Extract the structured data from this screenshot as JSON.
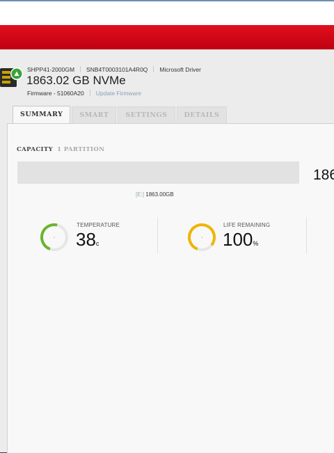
{
  "device": {
    "model": "SHPP41-2000GM",
    "serial": "SNB4T0003101A4R0Q",
    "driver": "Microsoft Driver",
    "title": "1863.02 GB NVMe",
    "firmware_label": "Firmware - 51060A20",
    "update_firmware_label": "Update Firmware",
    "icon": "ssd-drive-icon"
  },
  "tabs": [
    {
      "label": "SUMMARY",
      "active": true
    },
    {
      "label": "SMART",
      "active": false
    },
    {
      "label": "SETTINGS",
      "active": false
    },
    {
      "label": "DETAILS",
      "active": false
    }
  ],
  "capacity": {
    "heading": "CAPACITY",
    "partitions": "1 PARTITION",
    "total_visible": "186",
    "partition_drive": "[E:]",
    "partition_size": "1863.00GB",
    "used_fraction": 0.0
  },
  "metrics": [
    {
      "label": "TEMPERATURE",
      "value": "38",
      "unit": "c",
      "color": "#6ab42b",
      "level": 0.6,
      "icon": "temperature-gauge-icon"
    },
    {
      "label": "LIFE REMAINING",
      "value": "100",
      "unit": "%",
      "color": "#f0b400",
      "level": 1.0,
      "icon": "life-gauge-icon"
    }
  ],
  "colors": {
    "brand_red": "#d40a1a",
    "temperature": "#6ab42b",
    "life": "#f0b400"
  }
}
